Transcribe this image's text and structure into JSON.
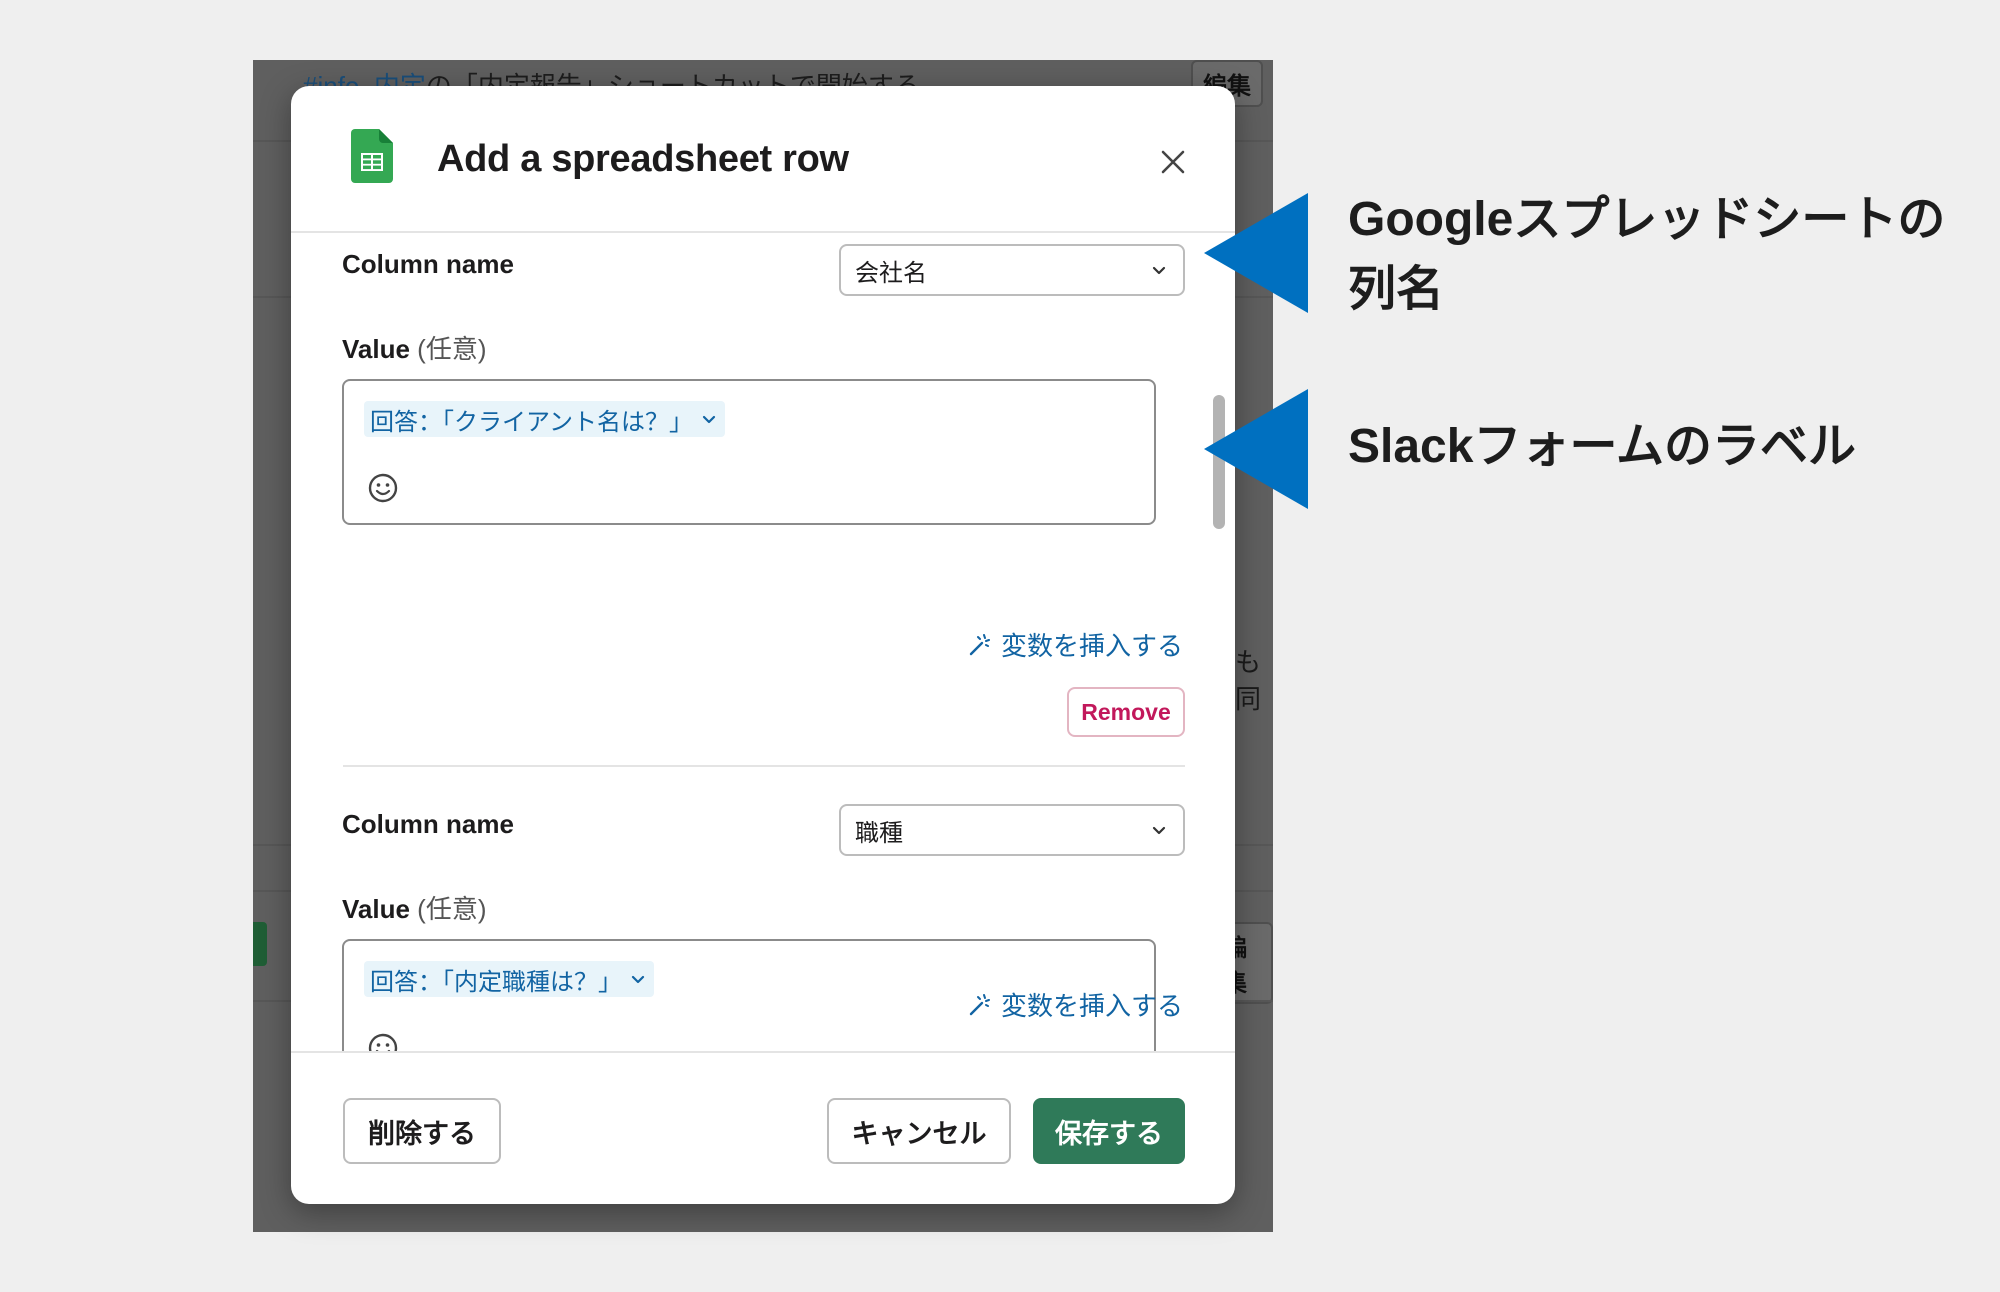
{
  "background": {
    "title_link": "#info_内定",
    "title_rest": "の「内定報告」ショートカットで開始する",
    "edit_label": "編集",
    "fragment_text": "も同",
    "colors": {
      "overlay": "#5f5f5f"
    }
  },
  "modal": {
    "title": "Add a spreadsheet row",
    "icon": "google-sheets-icon",
    "close_icon": "close-icon",
    "rows": [
      {
        "column_label": "Column name",
        "column_value": "会社名",
        "value_label": "Value",
        "value_optional": "(任意)",
        "token": "回答：「クライアント名は？」",
        "insert_variable": "変数を挿入する",
        "remove_label": "Remove"
      },
      {
        "column_label": "Column name",
        "column_value": "職種",
        "value_label": "Value",
        "value_optional": "(任意)",
        "token": "回答：「内定職種は？」",
        "insert_variable": "変数を挿入する"
      }
    ],
    "footer": {
      "delete_label": "削除する",
      "cancel_label": "キャンセル",
      "save_label": "保存する"
    },
    "colors": {
      "primary": "#2f7a59",
      "link": "#1264a3",
      "danger": "#c2185b"
    }
  },
  "annotations": {
    "column_note_line1": "Googleスプレッドシートの",
    "column_note_line2": "列名",
    "label_note": "Slackフォームのラベル",
    "arrow_color": "#0070c0"
  }
}
